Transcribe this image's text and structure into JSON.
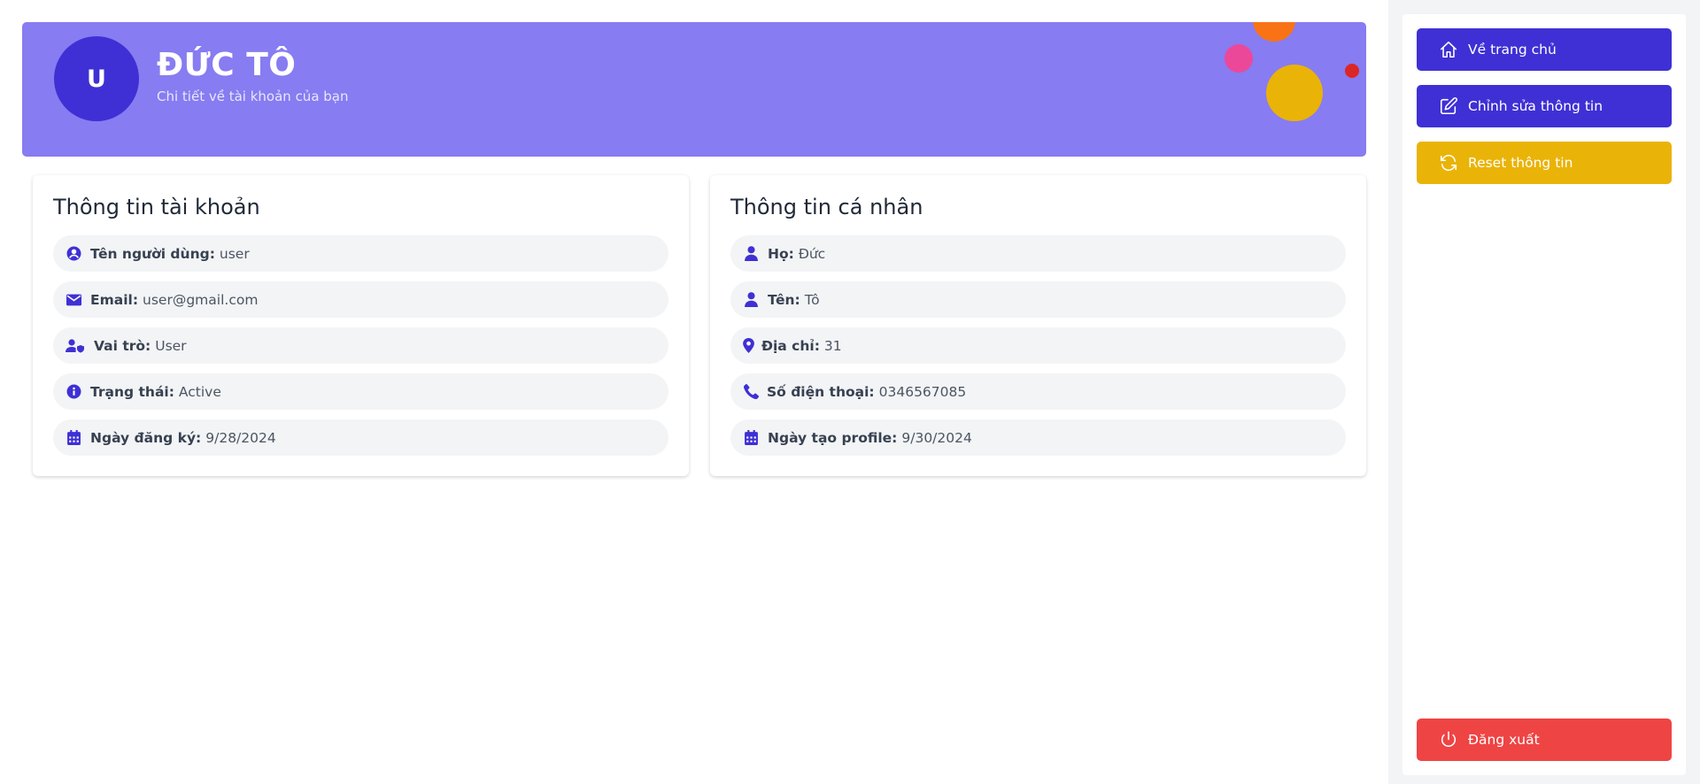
{
  "header": {
    "avatar_letter": "U",
    "name": "ĐỨC TÔ",
    "subtitle": "Chi tiết về tài khoản của bạn"
  },
  "account": {
    "title": "Thông tin tài khoản",
    "rows": [
      {
        "icon": "user-circle-icon",
        "label": "Tên người dùng:",
        "value": "user"
      },
      {
        "icon": "envelope-icon",
        "label": "Email:",
        "value": "user@gmail.com"
      },
      {
        "icon": "user-shield-icon",
        "label": "Vai trò:",
        "value": "User"
      },
      {
        "icon": "info-circle-icon",
        "label": "Trạng thái:",
        "value": "Active"
      },
      {
        "icon": "calendar-icon",
        "label": "Ngày đăng ký:",
        "value": "9/28/2024"
      }
    ]
  },
  "personal": {
    "title": "Thông tin cá nhân",
    "rows": [
      {
        "icon": "user-icon",
        "label": "Họ:",
        "value": "Đức"
      },
      {
        "icon": "user-icon",
        "label": "Tên:",
        "value": "Tô"
      },
      {
        "icon": "map-pin-icon",
        "label": "Địa chỉ:",
        "value": "31"
      },
      {
        "icon": "phone-icon",
        "label": "Số điện thoại:",
        "value": "0346567085"
      },
      {
        "icon": "calendar-icon",
        "label": "Ngày tạo profile:",
        "value": "9/30/2024"
      }
    ]
  },
  "sidebar": {
    "home_label": "Về trang chủ",
    "edit_label": "Chỉnh sửa thông tin",
    "reset_label": "Reset thông tin",
    "logout_label": "Đăng xuất"
  },
  "colors": {
    "primary": "#3f30d5",
    "hero_bg": "#877cf1",
    "reset": "#eab308",
    "logout": "#ef4444"
  }
}
